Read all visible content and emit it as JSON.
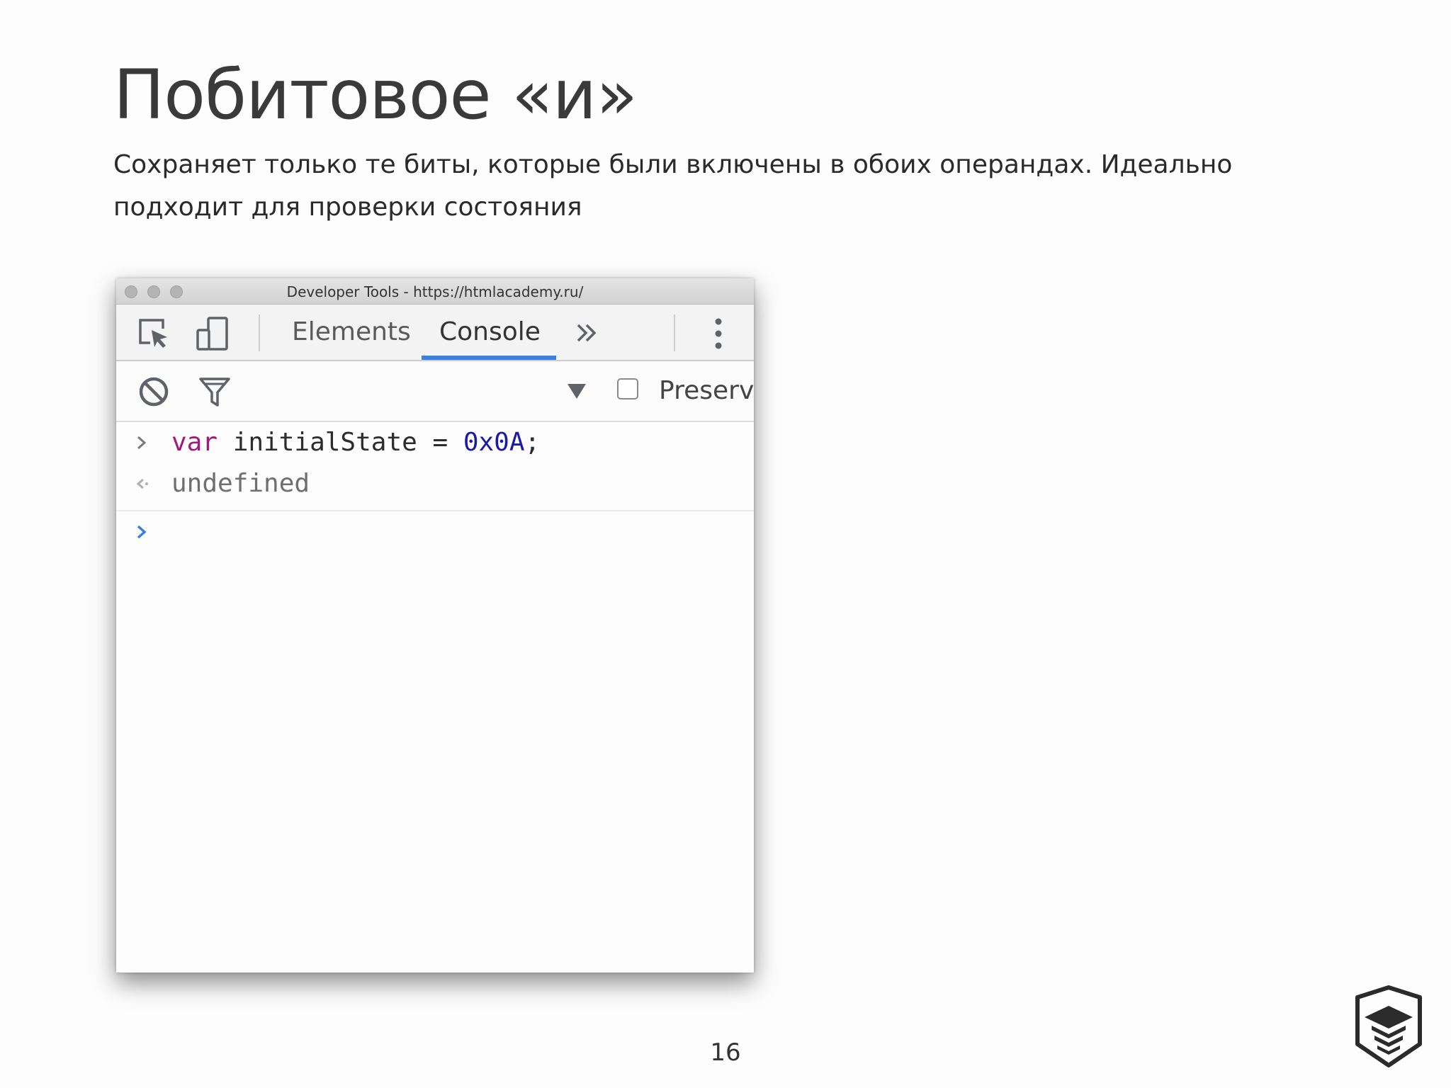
{
  "slide": {
    "title": "Побитовое «и»",
    "subtitle": "Сохраняет только те биты, которые были включены в обоих операндах. Идеально подходит для проверки состояния",
    "page_number": "16"
  },
  "window": {
    "title": "Developer Tools - https://htmlacademy.ru/"
  },
  "toolbar": {
    "tabs": [
      {
        "label": "Elements",
        "active": false
      },
      {
        "label": "Console",
        "active": true
      }
    ],
    "icons": [
      "inspect-element-icon",
      "device-toolbar-icon",
      "more-tabs-icon",
      "kebab-menu-icon"
    ]
  },
  "filterbar": {
    "preserve_label": "Preserv",
    "preserve_checked": false,
    "icons": [
      "clear-console-icon",
      "filter-icon",
      "dropdown-triangle-icon"
    ]
  },
  "console": {
    "input": {
      "keyword": "var",
      "identifier": " initialState = ",
      "number": "0x0A",
      "terminator": ";"
    },
    "result": "undefined"
  },
  "colors": {
    "accent": "#3b7fe2",
    "keyword": "#a2187c",
    "number": "#1a1aa6",
    "result": "#6f6f6f"
  }
}
